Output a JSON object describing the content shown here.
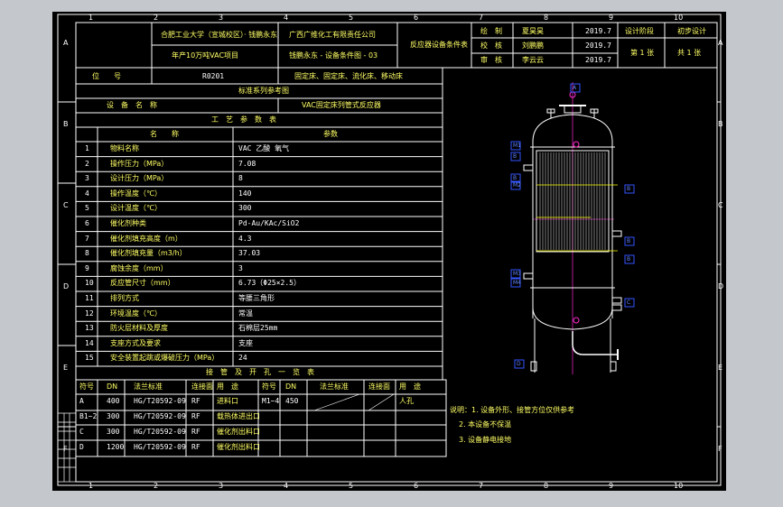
{
  "colors": {
    "frame": "#ffffff",
    "yellow": "#ffff00",
    "magenta": "#ff2ad0",
    "blue": "#3355ff",
    "background": "#c4c8cc",
    "paper": "#000000"
  },
  "title_block": {
    "university": "合肥工业大学（宣城校区）· 钱鹏永东",
    "project": "年产10万吨VAC项目",
    "company": "广西广维化工有限责任公司",
    "drawing_no": "钱鹏永东 - 设备条件图 - 03",
    "drawing_title": "反应器设备条件表",
    "position_label": "位　　号",
    "position_value": "R0201",
    "type_value": "固定床、固定床、流化床、移动床",
    "roles": [
      {
        "role": "绘　制",
        "name": "夏昊昊",
        "date": "2019.7"
      },
      {
        "role": "校　核",
        "name": "刘鹏鹏",
        "date": "2019.7"
      },
      {
        "role": "审　核",
        "name": "李云云",
        "date": "2019.7"
      }
    ],
    "stage_label": "设计阶段",
    "stage_value": "初步设计",
    "sheet": "第 1 张",
    "total": "共 1 张"
  },
  "design_table": {
    "standard": "标准系列参考图",
    "equipment_label": "设　备　名　称",
    "equipment_value": "VAC固定床列管式反应器",
    "process_header": "工　艺　参　数　表",
    "col_name": "名　　称",
    "col_param": "参数",
    "rows": [
      {
        "no": "1",
        "name": "物料名称",
        "value": "VAC 乙酸 氧气"
      },
      {
        "no": "2",
        "name": "操作压力（MPa）",
        "value": "7.08"
      },
      {
        "no": "3",
        "name": "设计压力（MPa）",
        "value": "8"
      },
      {
        "no": "4",
        "name": "操作温度（℃）",
        "value": "140"
      },
      {
        "no": "5",
        "name": "设计温度（℃）",
        "value": "300"
      },
      {
        "no": "6",
        "name": "催化剂种类",
        "value": "Pd-Au/KAc/SiO2"
      },
      {
        "no": "7",
        "name": "催化剂填充高度（m）",
        "value": "4.3"
      },
      {
        "no": "8",
        "name": "催化剂填充量（m3/h）",
        "value": "37.03"
      },
      {
        "no": "9",
        "name": "腐蚀余度（mm）",
        "value": "3"
      },
      {
        "no": "10",
        "name": "反应管尺寸（mm）",
        "value": "6.73（Φ25×2.5）"
      },
      {
        "no": "11",
        "name": "排列方式",
        "value": "等腰三角形"
      },
      {
        "no": "12",
        "name": "环境温度（℃）",
        "value": "常温"
      },
      {
        "no": "13",
        "name": "防火层材料及厚度",
        "value": "石棉层25mm"
      },
      {
        "no": "14",
        "name": "支座方式及要求",
        "value": "支座"
      },
      {
        "no": "15",
        "name": "安全装置起跳或爆破压力（MPa）",
        "value": "24"
      }
    ]
  },
  "nozzle_table": {
    "header": "接　管　及　开　孔　一　览　表",
    "cols": [
      "符号",
      "DN",
      "法兰标准",
      "连接面",
      "用　途",
      "符号",
      "DN",
      "法兰标准",
      "连接面",
      "用　途"
    ],
    "rows": [
      {
        "sym": "A",
        "dn": "400",
        "std": "HG/T20592-09",
        "face": "RF",
        "use": "进料口",
        "sym2": "M1~4",
        "dn2": "450",
        "std2": "",
        "face2": "",
        "use2": "人孔"
      },
      {
        "sym": "B1~2",
        "dn": "300",
        "std": "HG/T20592-09",
        "face": "RF",
        "use": "载热体进出口",
        "sym2": "",
        "dn2": "",
        "std2": "",
        "face2": "",
        "use2": ""
      },
      {
        "sym": "C",
        "dn": "300",
        "std": "HG/T20592-09",
        "face": "RF",
        "use": "催化剂出料口",
        "sym2": "",
        "dn2": "",
        "std2": "",
        "face2": "",
        "use2": ""
      },
      {
        "sym": "D",
        "dn": "1200",
        "std": "HG/T20592-09",
        "face": "RF",
        "use": "催化剂出料口",
        "sym2": "",
        "dn2": "",
        "std2": "",
        "face2": "",
        "use2": ""
      }
    ]
  },
  "notes": [
    "说明：1. 设备外形、接管方位仅供参考",
    "2. 本设备不保温",
    "3. 设备静电接地"
  ],
  "grid": {
    "top": [
      "1",
      "2",
      "3",
      "4",
      "5",
      "6",
      "7",
      "8",
      "9",
      "10"
    ],
    "side": [
      "A",
      "B",
      "C",
      "D",
      "E",
      "F"
    ]
  },
  "callouts": [
    "A",
    "M1",
    "B",
    "B",
    "B",
    "M2",
    "B",
    "B",
    "M3",
    "M4",
    "C",
    "D"
  ]
}
